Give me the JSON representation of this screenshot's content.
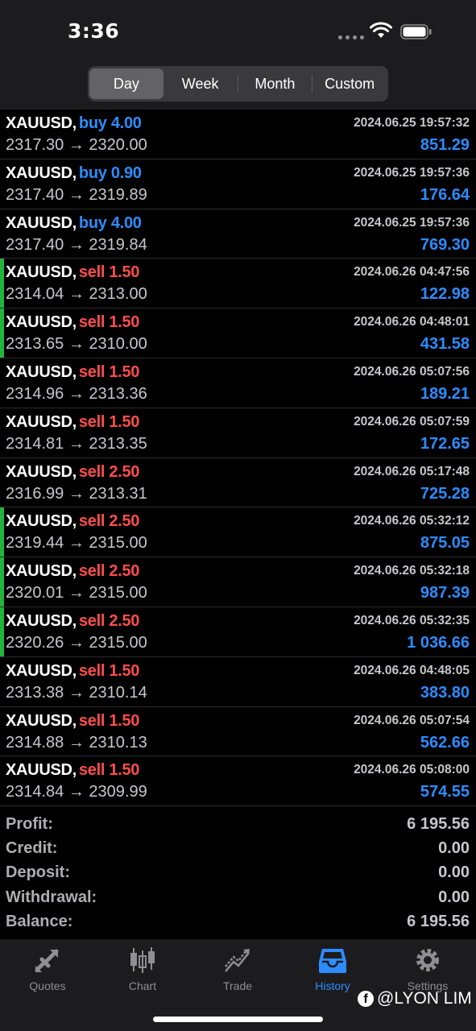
{
  "status": {
    "time": "3:36"
  },
  "segments": [
    "Day",
    "Week",
    "Month",
    "Custom"
  ],
  "active_segment": "Day",
  "trades": [
    {
      "symbol": "XAUUSD,",
      "side": "buy",
      "volume": "4.00",
      "datetime": "2024.06.25 19:57:32",
      "open": "2317.30",
      "close": "2320.00",
      "arrow": "→",
      "profit": "851.29",
      "marked": false
    },
    {
      "symbol": "XAUUSD,",
      "side": "buy",
      "volume": "0.90",
      "datetime": "2024.06.25 19:57:36",
      "open": "2317.40",
      "close": "2319.89",
      "arrow": "→",
      "profit": "176.64",
      "marked": false
    },
    {
      "symbol": "XAUUSD,",
      "side": "buy",
      "volume": "4.00",
      "datetime": "2024.06.25 19:57:36",
      "open": "2317.40",
      "close": "2319.84",
      "arrow": "→",
      "profit": "769.30",
      "marked": false
    },
    {
      "symbol": "XAUUSD,",
      "side": "sell",
      "volume": "1.50",
      "datetime": "2024.06.26 04:47:56",
      "open": "2314.04",
      "close": "2313.00",
      "arrow": "→",
      "profit": "122.98",
      "marked": true
    },
    {
      "symbol": "XAUUSD,",
      "side": "sell",
      "volume": "1.50",
      "datetime": "2024.06.26 04:48:01",
      "open": "2313.65",
      "close": "2310.00",
      "arrow": "→",
      "profit": "431.58",
      "marked": true
    },
    {
      "symbol": "XAUUSD,",
      "side": "sell",
      "volume": "1.50",
      "datetime": "2024.06.26 05:07:56",
      "open": "2314.96",
      "close": "2313.36",
      "arrow": "→",
      "profit": "189.21",
      "marked": false
    },
    {
      "symbol": "XAUUSD,",
      "side": "sell",
      "volume": "1.50",
      "datetime": "2024.06.26 05:07:59",
      "open": "2314.81",
      "close": "2313.35",
      "arrow": "→",
      "profit": "172.65",
      "marked": false
    },
    {
      "symbol": "XAUUSD,",
      "side": "sell",
      "volume": "2.50",
      "datetime": "2024.06.26 05:17:48",
      "open": "2316.99",
      "close": "2313.31",
      "arrow": "→",
      "profit": "725.28",
      "marked": false
    },
    {
      "symbol": "XAUUSD,",
      "side": "sell",
      "volume": "2.50",
      "datetime": "2024.06.26 05:32:12",
      "open": "2319.44",
      "close": "2315.00",
      "arrow": "→",
      "profit": "875.05",
      "marked": true
    },
    {
      "symbol": "XAUUSD,",
      "side": "sell",
      "volume": "2.50",
      "datetime": "2024.06.26 05:32:18",
      "open": "2320.01",
      "close": "2315.00",
      "arrow": "→",
      "profit": "987.39",
      "marked": true
    },
    {
      "symbol": "XAUUSD,",
      "side": "sell",
      "volume": "2.50",
      "datetime": "2024.06.26 05:32:35",
      "open": "2320.26",
      "close": "2315.00",
      "arrow": "→",
      "profit": "1 036.66",
      "marked": true
    },
    {
      "symbol": "XAUUSD,",
      "side": "sell",
      "volume": "1.50",
      "datetime": "2024.06.26 04:48:05",
      "open": "2313.38",
      "close": "2310.14",
      "arrow": "→",
      "profit": "383.80",
      "marked": false
    },
    {
      "symbol": "XAUUSD,",
      "side": "sell",
      "volume": "1.50",
      "datetime": "2024.06.26 05:07:54",
      "open": "2314.88",
      "close": "2310.13",
      "arrow": "→",
      "profit": "562.66",
      "marked": false
    },
    {
      "symbol": "XAUUSD,",
      "side": "sell",
      "volume": "1.50",
      "datetime": "2024.06.26 05:08:00",
      "open": "2314.84",
      "close": "2309.99",
      "arrow": "→",
      "profit": "574.55",
      "marked": false
    }
  ],
  "summary": [
    {
      "label": "Profit:",
      "value": "6 195.56"
    },
    {
      "label": "Credit:",
      "value": "0.00"
    },
    {
      "label": "Deposit:",
      "value": "0.00"
    },
    {
      "label": "Withdrawal:",
      "value": "0.00"
    },
    {
      "label": "Balance:",
      "value": "6 195.56"
    }
  ],
  "tabs": [
    {
      "label": "Quotes",
      "icon": "quotes-icon"
    },
    {
      "label": "Chart",
      "icon": "chart-icon"
    },
    {
      "label": "Trade",
      "icon": "trade-icon"
    },
    {
      "label": "History",
      "icon": "history-icon"
    },
    {
      "label": "Settings",
      "icon": "settings-icon"
    }
  ],
  "active_tab": "History",
  "watermark": {
    "icon": "facebook-icon",
    "text": "@LYON LIM"
  },
  "colors": {
    "buy": "#2d8cff",
    "sell": "#ff4d4d",
    "profit": "#2d8cff",
    "marker": "#22b43c",
    "active_tab": "#2d8cff"
  }
}
